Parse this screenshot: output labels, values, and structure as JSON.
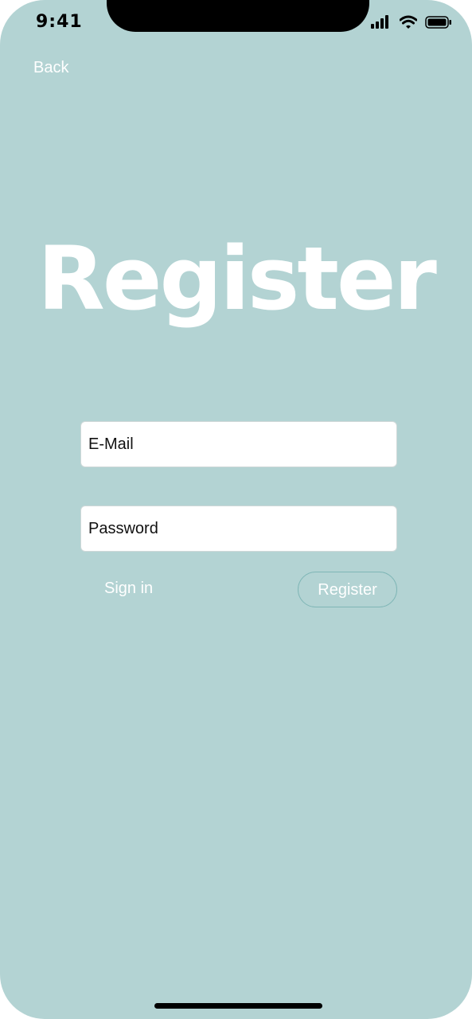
{
  "status_bar": {
    "time": "9:41",
    "icons": [
      "signal-icon",
      "wifi-icon",
      "battery-icon"
    ]
  },
  "nav": {
    "back_label": "Back"
  },
  "screen": {
    "title": "Register"
  },
  "form": {
    "email_placeholder": "E-Mail",
    "email_value": "",
    "password_placeholder": "Password",
    "password_value": "",
    "sign_in_label": "Sign in",
    "register_label": "Register"
  },
  "colors": {
    "background": "#b3d3d3",
    "text_on_background": "#ffffff",
    "field_background": "#ffffff",
    "button_border": "#7fb6b6"
  }
}
